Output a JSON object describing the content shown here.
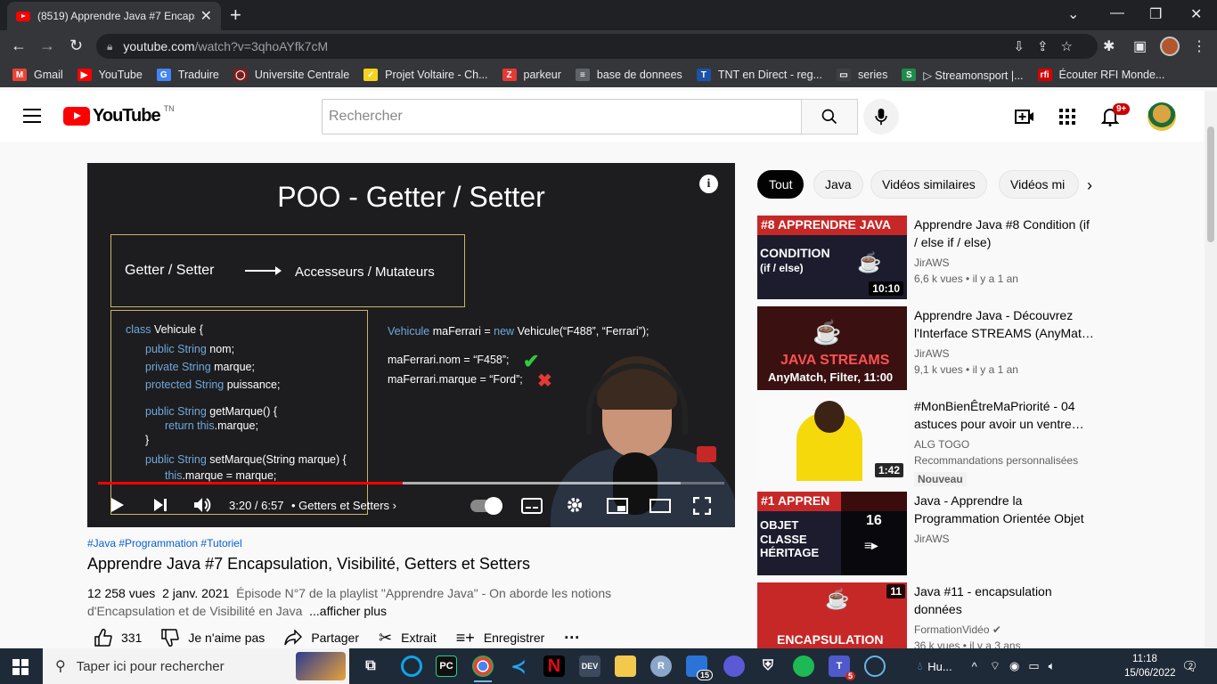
{
  "browser": {
    "tab_title": "(8519) Apprendre Java #7 Encaps",
    "url_host": "youtube.com",
    "url_path": "/watch?v=3qhoAYfk7cM",
    "bookmarks": [
      {
        "label": "Gmail",
        "color": "#ea4335",
        "glyph": "M"
      },
      {
        "label": "YouTube",
        "color": "#ff0000",
        "glyph": "▶"
      },
      {
        "label": "Traduire",
        "color": "#4285f4",
        "glyph": "G"
      },
      {
        "label": "Universite Centrale",
        "color": "#7a1d1d",
        "glyph": "◯"
      },
      {
        "label": "Projet Voltaire - Ch...",
        "color": "#f5d21f",
        "glyph": "✓"
      },
      {
        "label": "parkeur",
        "color": "#e53935",
        "glyph": "Z"
      },
      {
        "label": "base de donnees",
        "color": "#5f6368",
        "glyph": "≡"
      },
      {
        "label": "TNT en Direct - reg...",
        "color": "#1a53a8",
        "glyph": "T"
      },
      {
        "label": "series",
        "color": "#3c4043",
        "glyph": "▭"
      },
      {
        "label": "▷ Streamonsport |...",
        "color": "#1f8b4c",
        "glyph": "S"
      },
      {
        "label": "Écouter RFI Monde...",
        "color": "#d50000",
        "glyph": "rfi"
      }
    ]
  },
  "youtube": {
    "logo_text": "YouTube",
    "country_code": "TN",
    "search_placeholder": "Rechercher",
    "notification_count": "9+"
  },
  "player": {
    "slide_title": "POO - Getter / Setter",
    "box_left": "Getter / Setter",
    "box_right": "Accesseurs / Mutateurs",
    "code_left": [
      {
        "kw": "class",
        "rest": " Vehicule {"
      },
      {
        "kw": "public String",
        "rest": " nom;"
      },
      {
        "kw": "private String",
        "rest": " marque;"
      },
      {
        "kw": "protected String",
        "rest": " puissance;"
      },
      {
        "kw": "public String",
        "rest": " getMarque() {"
      },
      {
        "kw": "return this",
        "rest": ".marque;"
      },
      {
        "kw": "",
        "rest": "}"
      },
      {
        "kw": "public String",
        "rest": " setMarque(String marque) {"
      },
      {
        "kw": "this",
        "rest": ".marque = marque;"
      }
    ],
    "code_right": [
      {
        "kw": "Vehicule",
        "rest": " maFerrari = ",
        "kw2": "new",
        "rest2": " Vehicule(“F488”, “Ferrari”);"
      },
      {
        "kw": "",
        "rest": "maFerrari.nom = “F458”;",
        "kw2": "",
        "rest2": ""
      },
      {
        "kw": "",
        "rest": "maFerrari.marque = “Ford”;",
        "kw2": "",
        "rest2": ""
      }
    ],
    "time": "3:20 / 6:57",
    "chapter": "• Getters et Setters",
    "progress_played": 0.486,
    "progress_loaded": 0.93
  },
  "video": {
    "hashtags": "#Java #Programmation #Tutoriel",
    "title": "Apprendre Java #7 Encapsulation, Visibilité, Getters et Setters",
    "views": "12 258 vues",
    "date": "2 janv. 2021",
    "description": "Épisode N°7 de la playlist \"Apprendre Java\" - On aborde les notions d'Encapsulation et de Visibilité en Java",
    "more": "...afficher plus",
    "likes": "331",
    "dislike_label": "Je n'aime pas",
    "share_label": "Partager",
    "clip_label": "Extrait",
    "save_label": "Enregistrer"
  },
  "chips": [
    "Tout",
    "Java",
    "Vidéos similaires",
    "Vidéos mi"
  ],
  "recommendations": [
    {
      "title": "Apprendre Java #8 Condition (if / else if / else)",
      "channel": "JirAWS",
      "views": "6,6 k vues • il y a 1 an",
      "duration": "10:10",
      "thumb_lines": [
        "#8 APPRENDRE JAVA",
        "CONDITION",
        "(if / else)"
      ],
      "badge": ""
    },
    {
      "title": "Apprendre Java - Découvrez l'Interface STREAMS (AnyMat…",
      "channel": "JirAWS",
      "views": "9,1 k vues • il y a 1 an",
      "duration": "",
      "thumb_lines": [
        "JAVA STREAMS",
        "AnyMatch, Filter, 11:00"
      ],
      "badge": ""
    },
    {
      "title": "#MonBienÊtreMaPriorité - 04 astuces pour avoir un ventre…",
      "channel": "ALG TOGO",
      "views": "Recommandations personnalisées",
      "duration": "1:42",
      "thumb_lines": [],
      "badge": "Nouveau"
    },
    {
      "title": "Java - Apprendre la Programmation Orientée Objet",
      "channel": "JirAWS",
      "views": "",
      "duration": "",
      "thumb_lines": [
        "#1 APPREN",
        "OBJET",
        "CLASSE",
        "HÉRITAGE",
        "16"
      ],
      "badge": ""
    },
    {
      "title": "Java #11 - encapsulation données",
      "channel": "FormationVidéo",
      "views": "36 k vues • il y a 3 ans",
      "duration": "11",
      "thumb_lines": [
        "ENCAPSULATION"
      ],
      "badge": ""
    }
  ],
  "taskbar": {
    "search_placeholder": "Taper ici pour rechercher",
    "weather": "Hu...",
    "time": "11:18",
    "date": "15/06/2022",
    "notifications": "2",
    "vscode_badge": "15",
    "teams_badge": "5"
  }
}
